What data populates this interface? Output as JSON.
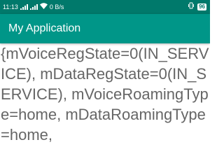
{
  "status_bar": {
    "time": "11:13",
    "data_speed": "0 B/s",
    "battery_level": "96",
    "icons": [
      "signal-icon",
      "signal-icon",
      "wifi-icon",
      "data-speed",
      "vibrate-icon",
      "battery-icon"
    ]
  },
  "app_bar": {
    "title": "My Application"
  },
  "main": {
    "text": "{mVoiceRegState=0(IN_SERVICE), mDataRegState=0(IN_SERVICE), mVoiceRoamingType=home, mDataRoamingType=home,"
  },
  "colors": {
    "status_bar": "#00796b",
    "app_bar": "#009688",
    "body_text": "#666666"
  }
}
